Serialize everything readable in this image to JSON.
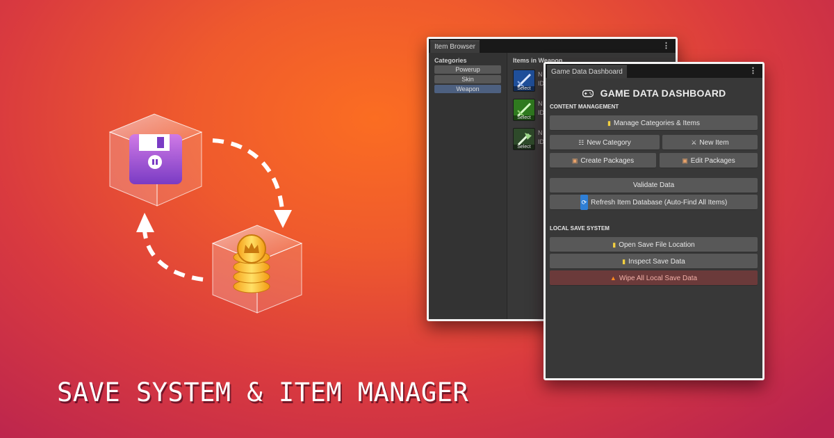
{
  "headline": "SAVE SYSTEM & ITEM MANAGER",
  "item_browser": {
    "tab_label": "Item Browser",
    "menu_icon": "⋮",
    "categories_label": "Categories",
    "categories": [
      "Powerup",
      "Skin",
      "Weapon"
    ],
    "selected_category": "Weapon",
    "items_label": "Items in Weapon",
    "items": [
      {
        "icon": "sword-icon",
        "select_label": "Select",
        "name": "N",
        "id_prefix": "ID"
      },
      {
        "icon": "green-sword-icon",
        "select_label": "Select",
        "name": "N",
        "id_prefix": "ID"
      },
      {
        "icon": "axe-icon",
        "select_label": "Select",
        "name": "N",
        "id_prefix": "ID"
      }
    ]
  },
  "dashboard": {
    "tab_label": "Game Data Dashboard",
    "menu_icon": "⋮",
    "title_icon": "gamepad-icon",
    "title": "GAME DATA DASHBOARD",
    "content_section": "CONTENT MANAGEMENT",
    "manage_btn": "Manage Categories & Items",
    "new_category_btn": "New Category",
    "new_item_btn": "New Item",
    "create_packages_btn": "Create Packages",
    "edit_packages_btn": "Edit Packages",
    "validate_btn": "Validate Data",
    "refresh_btn": "Refresh Item Database (Auto-Find All Items)",
    "save_section": "LOCAL SAVE SYSTEM",
    "open_save_btn": "Open Save File Location",
    "inspect_save_btn": "Inspect Save Data",
    "wipe_btn": "Wipe All Local Save Data"
  },
  "colors": {
    "danger_button": "#6b3a3a",
    "selected_category": "#4d6080",
    "floppy": "#b55bd2",
    "coin": "#f4c21c"
  }
}
